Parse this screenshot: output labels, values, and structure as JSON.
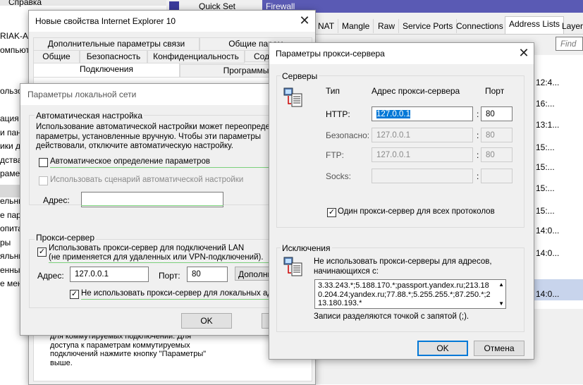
{
  "bg_left": {
    "menu_label": "Справка",
    "lines": [
      "RIAK-AD",
      "омпьюте",
      "",
      "",
      "ользов",
      "",
      "ация W",
      "и пане",
      "ики да",
      "дства",
      "раметры",
      "раметры о",
      "ельные п",
      "е параг",
      "опитан",
      "ры",
      "яльные",
      "енные",
      "е менн"
    ]
  },
  "winbox": {
    "toolbar_items": [
      "Quick Set",
      "Firewall"
    ],
    "tabs": [
      "NAT",
      "Mangle",
      "Raw",
      "Service Ports",
      "Connections",
      "Address Lists",
      "Layer7"
    ],
    "find_placeholder": "Find",
    "rows": [
      "12:4...",
      "16:...",
      "13:1...",
      "15:...",
      "15:...",
      "15:...",
      "15:...",
      "14:0...",
      "14:0...",
      "14:0..."
    ]
  },
  "ie_props": {
    "title": "Новые свойства Internet Explorer 10",
    "tabs_row1": [
      "Дополнительные параметры связи",
      "Общие парам"
    ],
    "tabs_row2": [
      "Общие",
      "Безопасность",
      "Конфиденциальность",
      "Сод"
    ],
    "tabs_row3": [
      "Подключения",
      "Программы"
    ],
    "bottom_text": "для коммутируемых подключений. Для доступа к параметрам коммутируемых подключений нажмите кнопку \"Параметры\" выше."
  },
  "lan": {
    "title": "Параметры локальной сети",
    "auto_group": "Автоматическая настройка",
    "auto_desc": "Использование автоматической настройки может переопредели параметры, установленные вручную. Чтобы эти параметры действовали, отключите автоматическую настройку.",
    "auto_detect": "Автоматическое определение параметров",
    "use_script": "Использовать сценарий автоматической настройки",
    "address_label": "Адрес:",
    "address_value": "",
    "proxy_group": "Прокси-сервер",
    "use_proxy_line1": "Использовать прокси-сервер для подключений LAN",
    "use_proxy_line2": "(не применяется для удаленных или VPN-подключений).",
    "proxy_address_label": "Адрес:",
    "proxy_address": "127.0.0.1",
    "port_label": "Порт:",
    "port_value": "80",
    "advanced_button": "Дополни",
    "bypass_local": "Не использовать прокси-сервер для локальных адре",
    "ok_button": "OK"
  },
  "proxy": {
    "title": "Параметры прокси-сервера",
    "servers_group": "Серверы",
    "col_type": "Тип",
    "col_address": "Адрес прокси-сервера",
    "col_port": "Порт",
    "rows": [
      {
        "label": "HTTP:",
        "address": "127.0.0.1",
        "port": "80",
        "enabled": true
      },
      {
        "label": "Безопасно:",
        "address": "127.0.0.1",
        "port": "80",
        "enabled": false
      },
      {
        "label": "FTP:",
        "address": "127.0.0.1",
        "port": "80",
        "enabled": false
      },
      {
        "label": "Socks:",
        "address": "",
        "port": "",
        "enabled": false
      }
    ],
    "same_proxy": "Один прокси-сервер для всех протоколов",
    "exceptions_group": "Исключения",
    "exceptions_desc": "Не использовать прокси-серверы для адресов, начинающихся с:",
    "exceptions_value": "3.33.243.*;5.188.170.*;passport.yandex.ru;213.180.204.24;yandex.ru;77.88.*;5.255.255.*;87.250.*;213.180.193.*",
    "exceptions_hint": "Записи разделяются точкой с запятой (;).",
    "ok_button": "OK",
    "cancel_button": "Отмена"
  }
}
